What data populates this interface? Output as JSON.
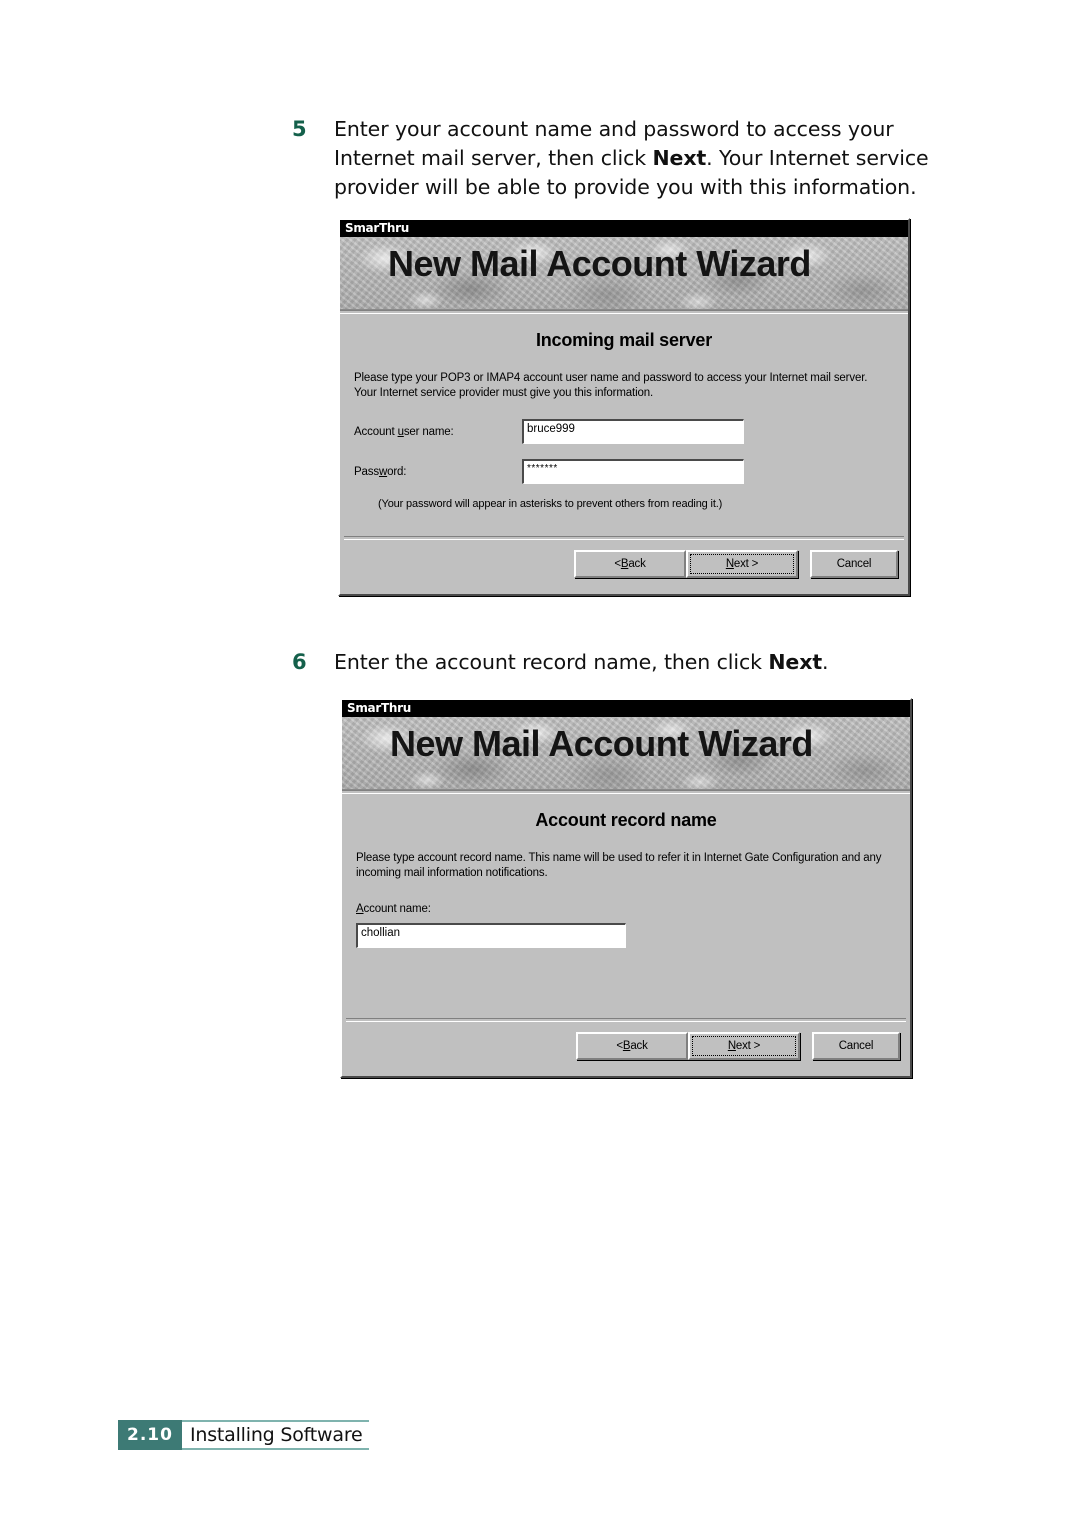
{
  "steps": [
    {
      "number": "5",
      "text_parts": {
        "before": "Enter your account name and password to access your Internet mail server, then click ",
        "bold": "Next",
        "after": ". Your Internet service provider will be able to provide you with this information."
      }
    },
    {
      "number": "6",
      "text_parts": {
        "before": "Enter the account record name, then click ",
        "bold": "Next",
        "after": "."
      }
    }
  ],
  "dialog1": {
    "titlebar": "SmarThru",
    "banner_title": "New Mail Account Wizard",
    "page_head": "Incoming mail server",
    "page_desc": "Please type your POP3 or IMAP4 account user name and password to access your Internet mail server. Your Internet service provider must give you this information.",
    "fields": {
      "username_label_pre": "Account ",
      "username_label_accel": "u",
      "username_label_post": "ser name:",
      "username_value": "bruce999",
      "password_label_pre": "Pass",
      "password_label_accel": "w",
      "password_label_post": "ord:",
      "password_value": "*******"
    },
    "hint": "(Your password will appear in asterisks to prevent others from reading it.)",
    "buttons": {
      "back_pre": "< ",
      "back_accel": "B",
      "back_post": "ack",
      "next_accel": "N",
      "next_post": "ext >",
      "cancel": "Cancel"
    }
  },
  "dialog2": {
    "titlebar": "SmarThru",
    "banner_title": "New Mail Account Wizard",
    "page_head": "Account record name",
    "page_desc": "Please type account record name. This name will be used to refer it in Internet Gate Configuration and any incoming mail information notifications.",
    "fields": {
      "account_label_accel": "A",
      "account_label_post": "ccount name:",
      "account_value": "chollian"
    },
    "buttons": {
      "back_pre": "< ",
      "back_accel": "B",
      "back_post": "ack",
      "next_accel": "N",
      "next_post": "ext >",
      "cancel": "Cancel"
    }
  },
  "footer": {
    "folio": "2.10",
    "section": "Installing Software"
  },
  "colors": {
    "accent_teal": "#3d7a75",
    "step_number_green": "#14604b",
    "dialog_face": "#c0c0c0"
  }
}
